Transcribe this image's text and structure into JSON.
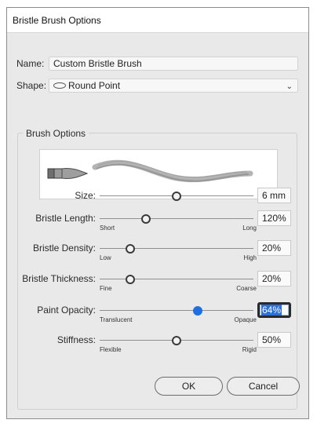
{
  "window": {
    "title": "Bristle Brush Options"
  },
  "name": {
    "label": "Name:",
    "value": "Custom Bristle Brush"
  },
  "shape": {
    "label": "Shape:",
    "value": "Round Point",
    "icon": "round-point-icon"
  },
  "brush_options": {
    "title": "Brush Options"
  },
  "sliders": [
    {
      "label": "Size:",
      "value": "6 mm",
      "min_label": "",
      "max_label": "",
      "position": 0.5
    },
    {
      "label": "Bristle Length:",
      "value": "120%",
      "min_label": "Short",
      "max_label": "Long",
      "position": 0.3
    },
    {
      "label": "Bristle Density:",
      "value": "20%",
      "min_label": "Low",
      "max_label": "High",
      "position": 0.2
    },
    {
      "label": "Bristle Thickness:",
      "value": "20%",
      "min_label": "Fine",
      "max_label": "Coarse",
      "position": 0.2
    },
    {
      "label": "Paint Opacity:",
      "value": "64%",
      "min_label": "Translucent",
      "max_label": "Opaque",
      "position": 0.64
    },
    {
      "label": "Stiffness:",
      "value": "50%",
      "min_label": "Flexible",
      "max_label": "Rigid",
      "position": 0.5
    }
  ],
  "buttons": {
    "ok": "OK",
    "cancel": "Cancel"
  },
  "colors": {
    "accent": "#1e6fe0",
    "selection": "#2d6fd6"
  }
}
